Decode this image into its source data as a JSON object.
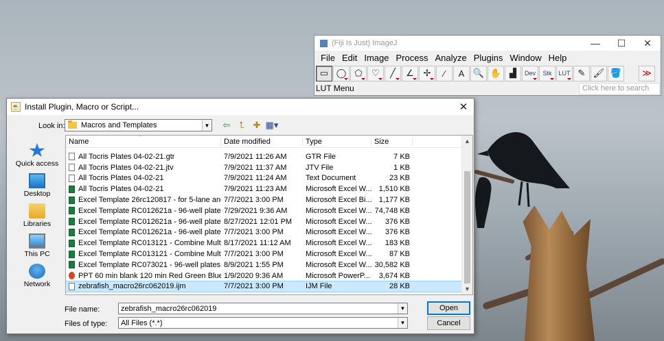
{
  "imagej": {
    "title": "(Fiji Is Just) ImageJ",
    "window_controls": [
      "—",
      "☐",
      "✕"
    ],
    "menu": [
      "File",
      "Edit",
      "Image",
      "Process",
      "Analyze",
      "Plugins",
      "Window",
      "Help"
    ],
    "tools": [
      {
        "name": "rectangle-tool",
        "glyph": "▭"
      },
      {
        "name": "oval-tool",
        "glyph": "◯"
      },
      {
        "name": "polygon-tool",
        "glyph": "⬠"
      },
      {
        "name": "freehand-tool",
        "glyph": "♡"
      },
      {
        "name": "line-tool",
        "glyph": "╱"
      },
      {
        "name": "angle-tool",
        "glyph": "∠"
      },
      {
        "name": "point-tool",
        "glyph": "✢"
      },
      {
        "name": "wand-tool",
        "glyph": "⁄"
      },
      {
        "name": "text-tool",
        "glyph": "A"
      },
      {
        "name": "magnifier-tool",
        "glyph": "🔍"
      },
      {
        "name": "hand-tool",
        "glyph": "✋"
      },
      {
        "name": "dropper-tool",
        "glyph": "▟"
      },
      {
        "name": "dev-tool",
        "glyph": "Dev"
      },
      {
        "name": "stk-tool",
        "glyph": "Stk"
      },
      {
        "name": "lut-tool",
        "glyph": "LUT"
      },
      {
        "name": "pencil-tool",
        "glyph": "✎"
      },
      {
        "name": "brush-tool",
        "glyph": "🖌"
      },
      {
        "name": "flood-fill-tool",
        "glyph": "🪣"
      },
      {
        "name": "more-tools",
        "glyph": "≫"
      }
    ],
    "status": "LUT Menu",
    "search_placeholder": "Click here to search"
  },
  "dialog": {
    "title": "Install Plugin, Macro or Script...",
    "close": "✕",
    "look_in_label": "Look in:",
    "look_in_value": "Macros and Templates",
    "places": [
      "Quick access",
      "Desktop",
      "Libraries",
      "This PC",
      "Network"
    ],
    "columns": {
      "name": "Name",
      "date": "Date modified",
      "type": "Type",
      "size": "Size"
    },
    "files": [
      {
        "name": "All Tocris Plates 04-02-21.gtr",
        "date": "7/9/2021 11:26 AM",
        "type": "GTR File",
        "size": "7 KB",
        "icon": "doc"
      },
      {
        "name": "All Tocris Plates 04-02-21.jtv",
        "date": "7/9/2021 11:37 AM",
        "type": "JTV File",
        "size": "1 KB",
        "icon": "doc"
      },
      {
        "name": "All Tocris Plates 04-02-21",
        "date": "7/9/2021 11:24 AM",
        "type": "Text Document",
        "size": "23 KB",
        "icon": "doc"
      },
      {
        "name": "All Tocris Plates 04-02-21",
        "date": "7/9/2021 11:23 AM",
        "type": "Microsoft Excel W...",
        "size": "1,510 KB",
        "icon": "xls"
      },
      {
        "name": "Excel Template 26rc120817 - for 5-lane and 6...",
        "date": "7/7/2021 3:00 PM",
        "type": "Microsoft Excel Bi...",
        "size": "1,177 KB",
        "icon": "xls"
      },
      {
        "name": "Excel Template RC012621a - 96-well plates - ...",
        "date": "7/29/2021 9:36 AM",
        "type": "Microsoft Excel W...",
        "size": "74,748 KB",
        "icon": "xls"
      },
      {
        "name": "Excel Template RC012621a - 96-well plates N...",
        "date": "8/27/2021 12:01 PM",
        "type": "Microsoft Excel W...",
        "size": "376 KB",
        "icon": "xls"
      },
      {
        "name": "Excel Template RC012621a - 96-well plates",
        "date": "7/7/2021 3:00 PM",
        "type": "Microsoft Excel W...",
        "size": "376 KB",
        "icon": "xls"
      },
      {
        "name": "Excel Template RC013121 - Combine Multipl...",
        "date": "8/17/2021 11:12 AM",
        "type": "Microsoft Excel W...",
        "size": "183 KB",
        "icon": "xls"
      },
      {
        "name": "Excel Template RC013121 - Combine Multipl...",
        "date": "7/7/2021 3:00 PM",
        "type": "Microsoft Excel W...",
        "size": "87 KB",
        "icon": "xls"
      },
      {
        "name": "Excel Template RC073021 - 96-well plates - P...",
        "date": "8/9/2021 1:55 PM",
        "type": "Microsoft Excel W...",
        "size": "30,582 KB",
        "icon": "xls"
      },
      {
        "name": "PPT 60 min blank 120 min Red Green Blue F...",
        "date": "1/9/2020 9:36 AM",
        "type": "Microsoft PowerP...",
        "size": "3,674 KB",
        "icon": "ppt"
      },
      {
        "name": "zebrafish_macro26rc062019.ijm",
        "date": "7/7/2021 3:00 PM",
        "type": "IJM File",
        "size": "28 KB",
        "icon": "doc",
        "selected": true
      }
    ],
    "file_name_label": "File name:",
    "file_name_value": "zebrafish_macro26rc062019",
    "file_type_label": "Files of type:",
    "file_type_value": "All Files (*.*)",
    "open_label": "Open",
    "cancel_label": "Cancel"
  }
}
